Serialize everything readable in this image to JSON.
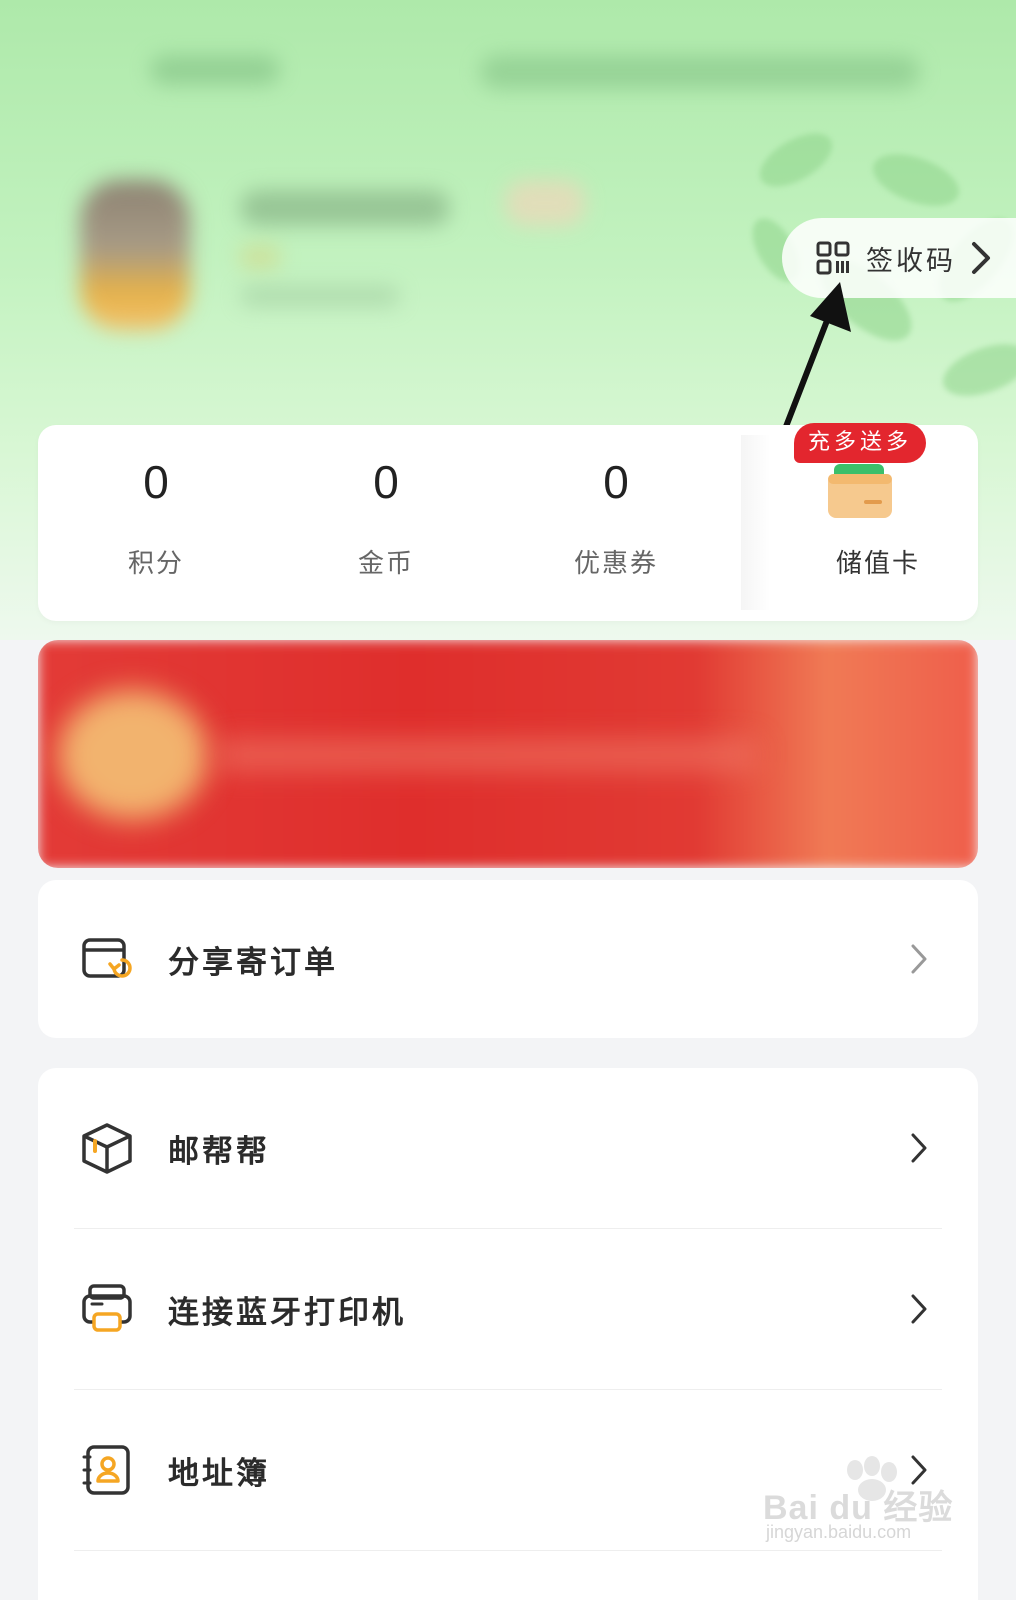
{
  "sign_code": {
    "label": "签收码"
  },
  "stats": [
    {
      "value": "0",
      "label": "积分"
    },
    {
      "value": "0",
      "label": "金币"
    },
    {
      "value": "0",
      "label": "优惠券"
    }
  ],
  "stored_value_card": {
    "badge": "充多送多",
    "label": "储值卡"
  },
  "menu": {
    "share": {
      "label": "分享寄订单"
    },
    "items": [
      {
        "label": "邮帮帮",
        "icon": "box-icon"
      },
      {
        "label": "连接蓝牙打印机",
        "icon": "printer-icon"
      },
      {
        "label": "地址簿",
        "icon": "address-book-icon"
      }
    ]
  },
  "watermark": {
    "brand": "Bai du 经验",
    "url": "jingyan.baidu.com"
  },
  "colors": {
    "accent_green": "#aee9aa",
    "badge_red": "#e3262e",
    "icon_orange": "#f5a623"
  }
}
